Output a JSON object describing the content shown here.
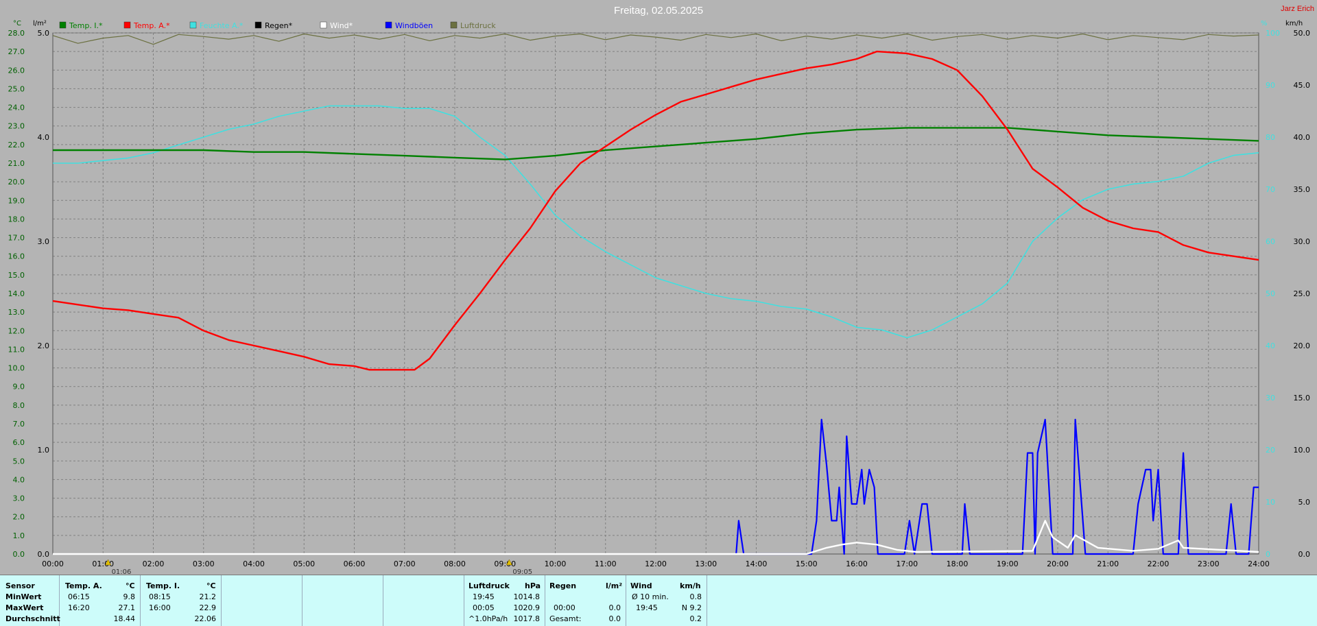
{
  "header": {
    "title": "Freitag, 02.05.2025",
    "station": "Jarz Erich",
    "unit_left_temp": "°C",
    "unit_left_rain": "l/m²",
    "unit_right_hum": "%",
    "unit_right_wind": "km/h"
  },
  "colors": {
    "background": "#b4b4b4",
    "temp_inside": "#008000",
    "temp_outside": "#ff0000",
    "humidity": "#40e0e0",
    "rain": "#000000",
    "wind": "#ffffff",
    "gusts": "#0000ff",
    "pressure": "#6b7040",
    "grid": "#808080",
    "stats_bg": "#cdfcfa"
  },
  "legend": [
    {
      "label": "Temp. I.*",
      "color": "#008000"
    },
    {
      "label": "Temp. A.*",
      "color": "#ff0000"
    },
    {
      "label": "Feuchte A.*",
      "color": "#40e0e0"
    },
    {
      "label": "Regen*",
      "color": "#000000"
    },
    {
      "label": "Wind*",
      "color": "#ffffff"
    },
    {
      "label": "Windböen",
      "color": "#0000ff"
    },
    {
      "label": "Luftdruck",
      "color": "#6b7040"
    }
  ],
  "markers": [
    {
      "label": "01:06",
      "time": 1.1
    },
    {
      "label": "09:05",
      "time": 9.083
    }
  ],
  "chart_data": {
    "type": "line",
    "x_range": [
      0,
      24
    ],
    "x_ticks": [
      "00:00",
      "01:00",
      "02:00",
      "03:00",
      "04:00",
      "05:00",
      "06:00",
      "07:00",
      "08:00",
      "09:00",
      "10:00",
      "11:00",
      "12:00",
      "13:00",
      "14:00",
      "15:00",
      "16:00",
      "17:00",
      "18:00",
      "19:00",
      "20:00",
      "21:00",
      "22:00",
      "23:00",
      "24:00"
    ],
    "y_temp_range": [
      0,
      28
    ],
    "y_temp_ticks": [
      "0.0",
      "1.0",
      "2.0",
      "3.0",
      "4.0",
      "5.0",
      "6.0",
      "7.0",
      "8.0",
      "9.0",
      "10.0",
      "11.0",
      "12.0",
      "13.0",
      "14.0",
      "15.0",
      "16.0",
      "17.0",
      "18.0",
      "19.0",
      "20.0",
      "21.0",
      "22.0",
      "23.0",
      "24.0",
      "25.0",
      "26.0",
      "27.0",
      "28.0"
    ],
    "y_rain_range": [
      0,
      5
    ],
    "y_rain_ticks": [
      "0.0",
      "1.0",
      "2.0",
      "3.0",
      "4.0",
      "5.0"
    ],
    "y_hum_range": [
      0,
      100
    ],
    "y_hum_ticks": [
      "0",
      "10",
      "20",
      "30",
      "40",
      "50",
      "60",
      "70",
      "80",
      "90",
      "100"
    ],
    "y_wind_range": [
      0,
      50
    ],
    "y_wind_ticks": [
      "0.0",
      "5.0",
      "10.0",
      "15.0",
      "20.0",
      "25.0",
      "30.0",
      "35.0",
      "40.0",
      "45.0",
      "50.0"
    ],
    "series": [
      {
        "name": "Temp. A.*",
        "axis": "temp",
        "points": [
          [
            0,
            13.6
          ],
          [
            0.5,
            13.4
          ],
          [
            1,
            13.2
          ],
          [
            1.5,
            13.1
          ],
          [
            2,
            12.9
          ],
          [
            2.5,
            12.7
          ],
          [
            3,
            12.0
          ],
          [
            3.5,
            11.5
          ],
          [
            4,
            11.2
          ],
          [
            4.5,
            10.9
          ],
          [
            5,
            10.6
          ],
          [
            5.5,
            10.2
          ],
          [
            6,
            10.1
          ],
          [
            6.3,
            9.9
          ],
          [
            7.2,
            9.9
          ],
          [
            7.5,
            10.5
          ],
          [
            8,
            12.3
          ],
          [
            8.5,
            14.0
          ],
          [
            9,
            15.8
          ],
          [
            9.5,
            17.5
          ],
          [
            10,
            19.5
          ],
          [
            10.5,
            21.0
          ],
          [
            11,
            21.9
          ],
          [
            11.5,
            22.8
          ],
          [
            12,
            23.6
          ],
          [
            12.5,
            24.3
          ],
          [
            13,
            24.7
          ],
          [
            13.5,
            25.1
          ],
          [
            14,
            25.5
          ],
          [
            14.5,
            25.8
          ],
          [
            15,
            26.1
          ],
          [
            15.5,
            26.3
          ],
          [
            16,
            26.6
          ],
          [
            16.4,
            27.0
          ],
          [
            17,
            26.9
          ],
          [
            17.5,
            26.6
          ],
          [
            18,
            26.0
          ],
          [
            18.5,
            24.6
          ],
          [
            19,
            22.8
          ],
          [
            19.5,
            20.7
          ],
          [
            20,
            19.7
          ],
          [
            20.5,
            18.6
          ],
          [
            21,
            17.9
          ],
          [
            21.5,
            17.5
          ],
          [
            22,
            17.3
          ],
          [
            22.5,
            16.6
          ],
          [
            23,
            16.2
          ],
          [
            23.5,
            16.0
          ],
          [
            24,
            15.8
          ]
        ]
      },
      {
        "name": "Temp. I.*",
        "axis": "temp",
        "points": [
          [
            0,
            21.7
          ],
          [
            1,
            21.7
          ],
          [
            2,
            21.7
          ],
          [
            3,
            21.7
          ],
          [
            4,
            21.6
          ],
          [
            5,
            21.6
          ],
          [
            6,
            21.5
          ],
          [
            7,
            21.4
          ],
          [
            8,
            21.3
          ],
          [
            9,
            21.2
          ],
          [
            10,
            21.4
          ],
          [
            11,
            21.7
          ],
          [
            12,
            21.9
          ],
          [
            13,
            22.1
          ],
          [
            14,
            22.3
          ],
          [
            15,
            22.6
          ],
          [
            16,
            22.8
          ],
          [
            17,
            22.9
          ],
          [
            18,
            22.9
          ],
          [
            19,
            22.9
          ],
          [
            20,
            22.7
          ],
          [
            21,
            22.5
          ],
          [
            22,
            22.4
          ],
          [
            23,
            22.3
          ],
          [
            24,
            22.2
          ]
        ]
      },
      {
        "name": "Feuchte A.*",
        "axis": "hum",
        "points": [
          [
            0,
            75
          ],
          [
            0.5,
            75
          ],
          [
            1,
            75.5
          ],
          [
            1.5,
            76
          ],
          [
            2,
            77
          ],
          [
            2.5,
            78.5
          ],
          [
            3,
            80
          ],
          [
            3.5,
            81.5
          ],
          [
            4,
            82.5
          ],
          [
            4.5,
            84
          ],
          [
            5,
            85
          ],
          [
            5.5,
            86
          ],
          [
            6,
            86
          ],
          [
            6.5,
            86
          ],
          [
            7,
            85.5
          ],
          [
            7.5,
            85.5
          ],
          [
            8,
            84
          ],
          [
            8.5,
            80
          ],
          [
            9,
            76.5
          ],
          [
            9.5,
            71
          ],
          [
            10,
            65
          ],
          [
            10.5,
            61
          ],
          [
            11,
            58
          ],
          [
            11.5,
            55.5
          ],
          [
            12,
            53
          ],
          [
            12.5,
            51.5
          ],
          [
            13,
            50
          ],
          [
            13.5,
            49
          ],
          [
            14,
            48.5
          ],
          [
            14.5,
            47.5
          ],
          [
            15,
            47
          ],
          [
            15.5,
            45.5
          ],
          [
            16,
            43.5
          ],
          [
            16.5,
            43
          ],
          [
            17,
            41.5
          ],
          [
            17.5,
            43
          ],
          [
            18,
            45.5
          ],
          [
            18.5,
            48
          ],
          [
            19,
            52
          ],
          [
            19.5,
            60
          ],
          [
            20,
            64.5
          ],
          [
            20.5,
            68
          ],
          [
            21,
            70
          ],
          [
            21.5,
            71
          ],
          [
            22,
            71.5
          ],
          [
            22.5,
            72.5
          ],
          [
            23,
            75
          ],
          [
            23.5,
            76.5
          ],
          [
            24,
            77
          ]
        ]
      },
      {
        "name": "Windböen",
        "axis": "wind",
        "points": [
          [
            13.6,
            0
          ],
          [
            13.65,
            3.2
          ],
          [
            13.75,
            0
          ],
          [
            15.1,
            0
          ],
          [
            15.2,
            3.2
          ],
          [
            15.3,
            12.9
          ],
          [
            15.4,
            8.5
          ],
          [
            15.5,
            3.2
          ],
          [
            15.6,
            3.2
          ],
          [
            15.65,
            6.4
          ],
          [
            15.75,
            0
          ],
          [
            15.8,
            11.3
          ],
          [
            15.9,
            4.8
          ],
          [
            16,
            4.8
          ],
          [
            16.1,
            8.1
          ],
          [
            16.15,
            4.8
          ],
          [
            16.25,
            8.1
          ],
          [
            16.35,
            6.4
          ],
          [
            16.42,
            0
          ],
          [
            16.95,
            0
          ],
          [
            17.05,
            3.2
          ],
          [
            17.15,
            0
          ],
          [
            17.3,
            4.8
          ],
          [
            17.4,
            4.8
          ],
          [
            17.5,
            0
          ],
          [
            18.1,
            0
          ],
          [
            18.15,
            4.8
          ],
          [
            18.25,
            0
          ],
          [
            19.3,
            0
          ],
          [
            19.4,
            9.7
          ],
          [
            19.5,
            9.7
          ],
          [
            19.55,
            0
          ],
          [
            19.6,
            9.7
          ],
          [
            19.75,
            12.9
          ],
          [
            19.9,
            0
          ],
          [
            20.3,
            0
          ],
          [
            20.35,
            12.9
          ],
          [
            20.55,
            0
          ],
          [
            20.6,
            0
          ],
          [
            21.5,
            0
          ],
          [
            21.6,
            4.8
          ],
          [
            21.75,
            8.1
          ],
          [
            21.85,
            8.1
          ],
          [
            21.9,
            3.2
          ],
          [
            22,
            8.1
          ],
          [
            22.1,
            0
          ],
          [
            22.4,
            0
          ],
          [
            22.5,
            9.7
          ],
          [
            22.6,
            0
          ],
          [
            23.35,
            0
          ],
          [
            23.45,
            4.8
          ],
          [
            23.55,
            0
          ],
          [
            23.8,
            0
          ],
          [
            23.9,
            6.4
          ],
          [
            24,
            6.4
          ]
        ]
      },
      {
        "name": "Wind*",
        "axis": "wind",
        "points": [
          [
            0,
            0
          ],
          [
            15,
            0
          ],
          [
            15.4,
            0.6
          ],
          [
            15.7,
            0.9
          ],
          [
            16,
            1.1
          ],
          [
            16.4,
            0.9
          ],
          [
            16.8,
            0.4
          ],
          [
            17.2,
            0.2
          ],
          [
            19.5,
            0.3
          ],
          [
            19.75,
            3.2
          ],
          [
            19.9,
            1.6
          ],
          [
            20.2,
            0.6
          ],
          [
            20.35,
            1.8
          ],
          [
            20.8,
            0.6
          ],
          [
            21.5,
            0.3
          ],
          [
            22,
            0.5
          ],
          [
            22.4,
            1.3
          ],
          [
            22.5,
            0.6
          ],
          [
            24,
            0.2
          ]
        ]
      },
      {
        "name": "Luftdruck",
        "axis": "hum",
        "points": [
          [
            0,
            99.5
          ],
          [
            0.5,
            98
          ],
          [
            1,
            99
          ],
          [
            1.5,
            99.5
          ],
          [
            2,
            97.8
          ],
          [
            2.5,
            99.7
          ],
          [
            3,
            99.3
          ],
          [
            3.5,
            98.8
          ],
          [
            4,
            99.5
          ],
          [
            4.5,
            98.4
          ],
          [
            5,
            99.8
          ],
          [
            5.5,
            99
          ],
          [
            6,
            99.6
          ],
          [
            6.5,
            98.8
          ],
          [
            7,
            99.7
          ],
          [
            7.5,
            98.5
          ],
          [
            8,
            99.5
          ],
          [
            8.5,
            99
          ],
          [
            9,
            99.8
          ],
          [
            9.5,
            98.6
          ],
          [
            10,
            99.4
          ],
          [
            10.5,
            99.8
          ],
          [
            11,
            98.7
          ],
          [
            11.5,
            99.6
          ],
          [
            12,
            99.2
          ],
          [
            12.5,
            98.6
          ],
          [
            13,
            99.7
          ],
          [
            13.5,
            99.1
          ],
          [
            14,
            99.8
          ],
          [
            14.5,
            98.5
          ],
          [
            15,
            99.4
          ],
          [
            15.5,
            98.8
          ],
          [
            16,
            99.6
          ],
          [
            16.5,
            99
          ],
          [
            17,
            99.8
          ],
          [
            17.5,
            98.6
          ],
          [
            18,
            99.3
          ],
          [
            18.5,
            99.7
          ],
          [
            19,
            98.8
          ],
          [
            19.5,
            99.5
          ],
          [
            20,
            99
          ],
          [
            20.5,
            99.8
          ],
          [
            21,
            98.7
          ],
          [
            21.5,
            99.5
          ],
          [
            22,
            99.1
          ],
          [
            22.5,
            98.7
          ],
          [
            23,
            99.7
          ],
          [
            23.5,
            99.4
          ],
          [
            24,
            99.6
          ]
        ]
      }
    ]
  },
  "stats": {
    "sensor": {
      "title": "Sensor",
      "rows": [
        "MinWert",
        "MaxWert",
        "Durchschnitt"
      ]
    },
    "temp_a": {
      "title": "Temp. A.",
      "unit": "°C",
      "min_time": "06:15",
      "min_val": "9.8",
      "max_time": "16:20",
      "max_val": "27.1",
      "avg": "18.44"
    },
    "temp_i": {
      "title": "Temp. I.",
      "unit": "°C",
      "min_time": "08:15",
      "min_val": "21.2",
      "max_time": "16:00",
      "max_val": "22.9",
      "avg": "22.06"
    },
    "pressure": {
      "title": "Luftdruck",
      "unit": "hPa",
      "min_time": "19:45",
      "min_val": "1014.8",
      "max_time": "00:05",
      "max_val": "1020.9",
      "trend_label": "^1.0hPa/h",
      "trend_val": "1017.8"
    },
    "rain": {
      "title": "Regen",
      "unit": "l/m²",
      "r1_time": "00:00",
      "r1_val": "0.0",
      "total_label": "Gesamt:",
      "total_val": "0.0"
    },
    "wind": {
      "title": "Wind",
      "unit": "km/h",
      "avg_label": "Ø 10 min.",
      "avg_val": "0.8",
      "max_time": "19:45",
      "max_val": "N 9.2",
      "mean_val": "0.2"
    }
  }
}
